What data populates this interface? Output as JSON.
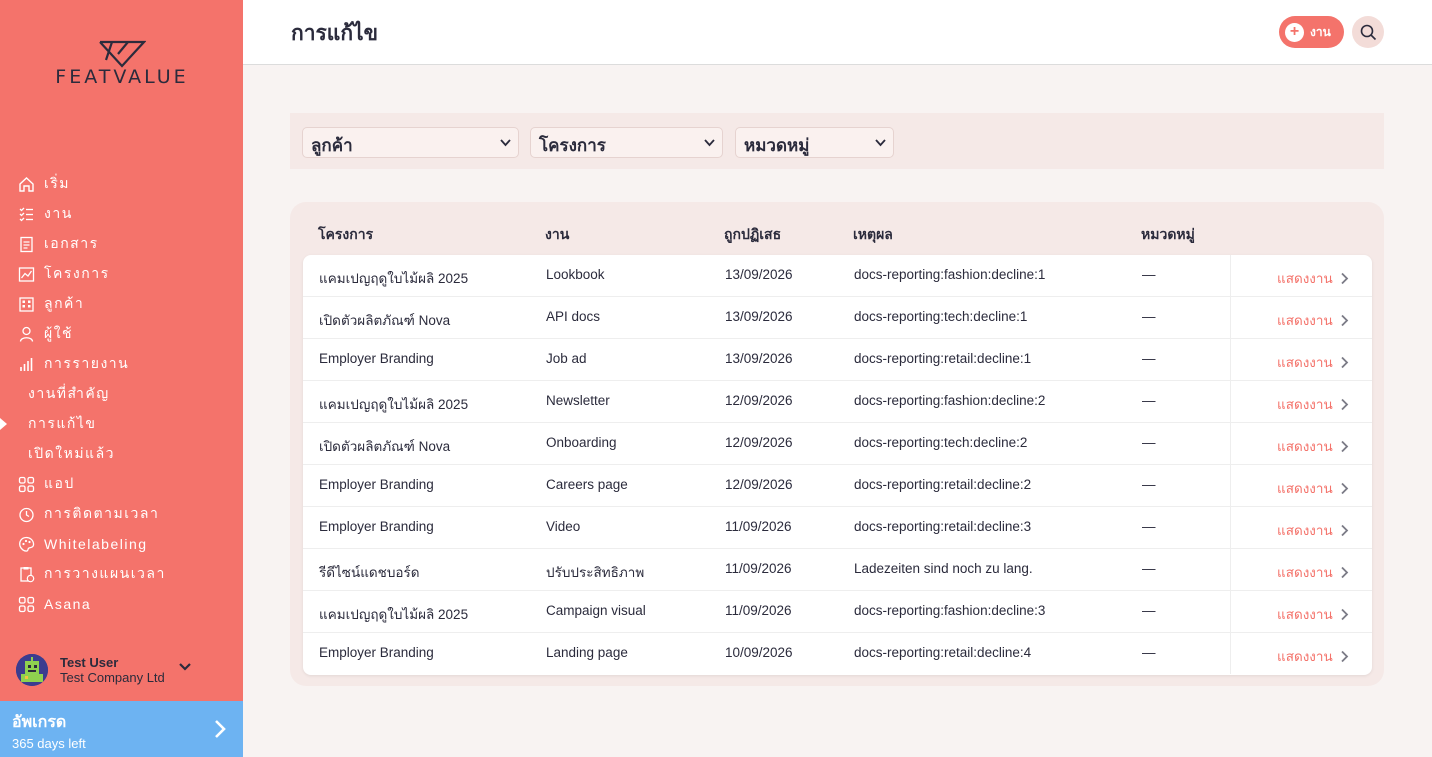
{
  "brand": {
    "name": "FEATVALUE",
    "accent": "#f4736b",
    "upgrade_color": "#6db3f2"
  },
  "sidebar": {
    "items": [
      {
        "label": "เริ่ม",
        "icon": "home-icon"
      },
      {
        "label": "งาน",
        "icon": "tasks-icon"
      },
      {
        "label": "เอกสาร",
        "icon": "documents-icon"
      },
      {
        "label": "โครงการ",
        "icon": "projects-icon"
      },
      {
        "label": "ลูกค้า",
        "icon": "clients-icon"
      },
      {
        "label": "ผู้ใช้",
        "icon": "user-icon"
      },
      {
        "label": "การรายงาน",
        "icon": "reporting-icon"
      },
      {
        "label": "งานที่สำคัญ",
        "sub": true
      },
      {
        "label": "การแก้ไข",
        "sub": true,
        "active": true
      },
      {
        "label": "เปิดใหม่แล้ว",
        "sub": true
      },
      {
        "label": "แอป",
        "icon": "apps-icon"
      },
      {
        "label": "การติดตามเวลา",
        "icon": "time-tracking-icon"
      },
      {
        "label": "Whitelabeling",
        "icon": "palette-icon"
      },
      {
        "label": "การวางแผนเวลา",
        "icon": "time-planning-icon"
      },
      {
        "label": "Asana",
        "icon": "apps-icon"
      }
    ],
    "user": {
      "name": "Test User",
      "company": "Test Company Ltd"
    },
    "upgrade": {
      "title": "อัพเกรด",
      "subtitle": "365 days left"
    }
  },
  "header": {
    "title": "การแก้ไข",
    "add_label": "งาน"
  },
  "filters": {
    "client": "ลูกค้า",
    "project": "โครงการ",
    "category": "หมวดหมู่"
  },
  "table": {
    "headers": {
      "project": "โครงการ",
      "task": "งาน",
      "rejected": "ถูกปฏิเสธ",
      "reason": "เหตุผล",
      "category": "หมวดหมู่"
    },
    "link_label": "แสดงงาน",
    "rows": [
      {
        "project": "แคมเปญฤดูใบไม้ผลิ 2025",
        "task": "Lookbook",
        "date": "13/09/2026",
        "reason": "docs-reporting:fashion:decline:1",
        "category": "—"
      },
      {
        "project": "เปิดตัวผลิตภัณฑ์ Nova",
        "task": "API docs",
        "date": "13/09/2026",
        "reason": "docs-reporting:tech:decline:1",
        "category": "—"
      },
      {
        "project": "Employer Branding",
        "task": "Job ad",
        "date": "13/09/2026",
        "reason": "docs-reporting:retail:decline:1",
        "category": "—"
      },
      {
        "project": "แคมเปญฤดูใบไม้ผลิ 2025",
        "task": "Newsletter",
        "date": "12/09/2026",
        "reason": "docs-reporting:fashion:decline:2",
        "category": "—"
      },
      {
        "project": "เปิดตัวผลิตภัณฑ์ Nova",
        "task": "Onboarding",
        "date": "12/09/2026",
        "reason": "docs-reporting:tech:decline:2",
        "category": "—"
      },
      {
        "project": "Employer Branding",
        "task": "Careers page",
        "date": "12/09/2026",
        "reason": "docs-reporting:retail:decline:2",
        "category": "—"
      },
      {
        "project": "Employer Branding",
        "task": "Video",
        "date": "11/09/2026",
        "reason": "docs-reporting:retail:decline:3",
        "category": "—"
      },
      {
        "project": "รีดีไซน์แดชบอร์ด",
        "task": "ปรับประสิทธิภาพ",
        "date": "11/09/2026",
        "reason": "Ladezeiten sind noch zu lang.",
        "category": "—"
      },
      {
        "project": "แคมเปญฤดูใบไม้ผลิ 2025",
        "task": "Campaign visual",
        "date": "11/09/2026",
        "reason": "docs-reporting:fashion:decline:3",
        "category": "—"
      },
      {
        "project": "Employer Branding",
        "task": "Landing page",
        "date": "10/09/2026",
        "reason": "docs-reporting:retail:decline:4",
        "category": "—"
      }
    ]
  }
}
